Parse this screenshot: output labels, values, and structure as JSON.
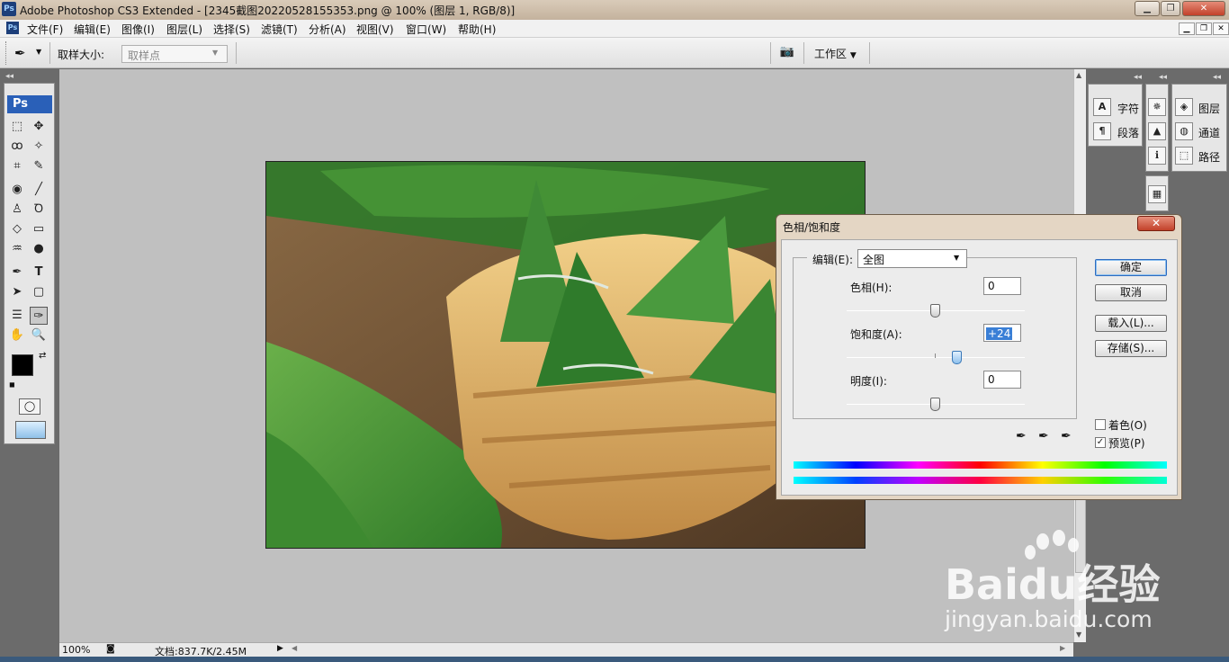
{
  "window": {
    "title": "Adobe Photoshop CS3 Extended - [2345截图20220528155353.png @ 100% (图层 1, RGB/8)]",
    "logo": "Ps"
  },
  "menu": [
    "文件(F)",
    "编辑(E)",
    "图像(I)",
    "图层(L)",
    "选择(S)",
    "滤镜(T)",
    "分析(A)",
    "视图(V)",
    "窗口(W)",
    "帮助(H)"
  ],
  "options_bar": {
    "sample_size_label": "取样大小:",
    "sample_size_value": "取样点",
    "workspace_label": "工作区"
  },
  "toolbox": {
    "logo": "Ps"
  },
  "right_panels": {
    "group1": [
      "字符",
      "段落"
    ],
    "group3": [
      "图层",
      "通道",
      "路径"
    ]
  },
  "statusbar": {
    "zoom": "100%",
    "doc": "文档:837.7K/2.45M"
  },
  "dialog": {
    "title": "色相/饱和度",
    "edit_label": "编辑(E):",
    "edit_value": "全图",
    "hue_label": "色相(H):",
    "hue_value": "0",
    "saturation_label": "饱和度(A):",
    "saturation_value": "+24",
    "lightness_label": "明度(I):",
    "lightness_value": "0",
    "buttons": {
      "ok": "确定",
      "cancel": "取消",
      "load": "载入(L)...",
      "save": "存储(S)..."
    },
    "colorize_label": "着色(O)",
    "colorize_checked": false,
    "preview_label": "预览(P)",
    "preview_checked": true
  },
  "watermark": {
    "brand": "Baidu经验",
    "url": "jingyan.baidu.com"
  }
}
